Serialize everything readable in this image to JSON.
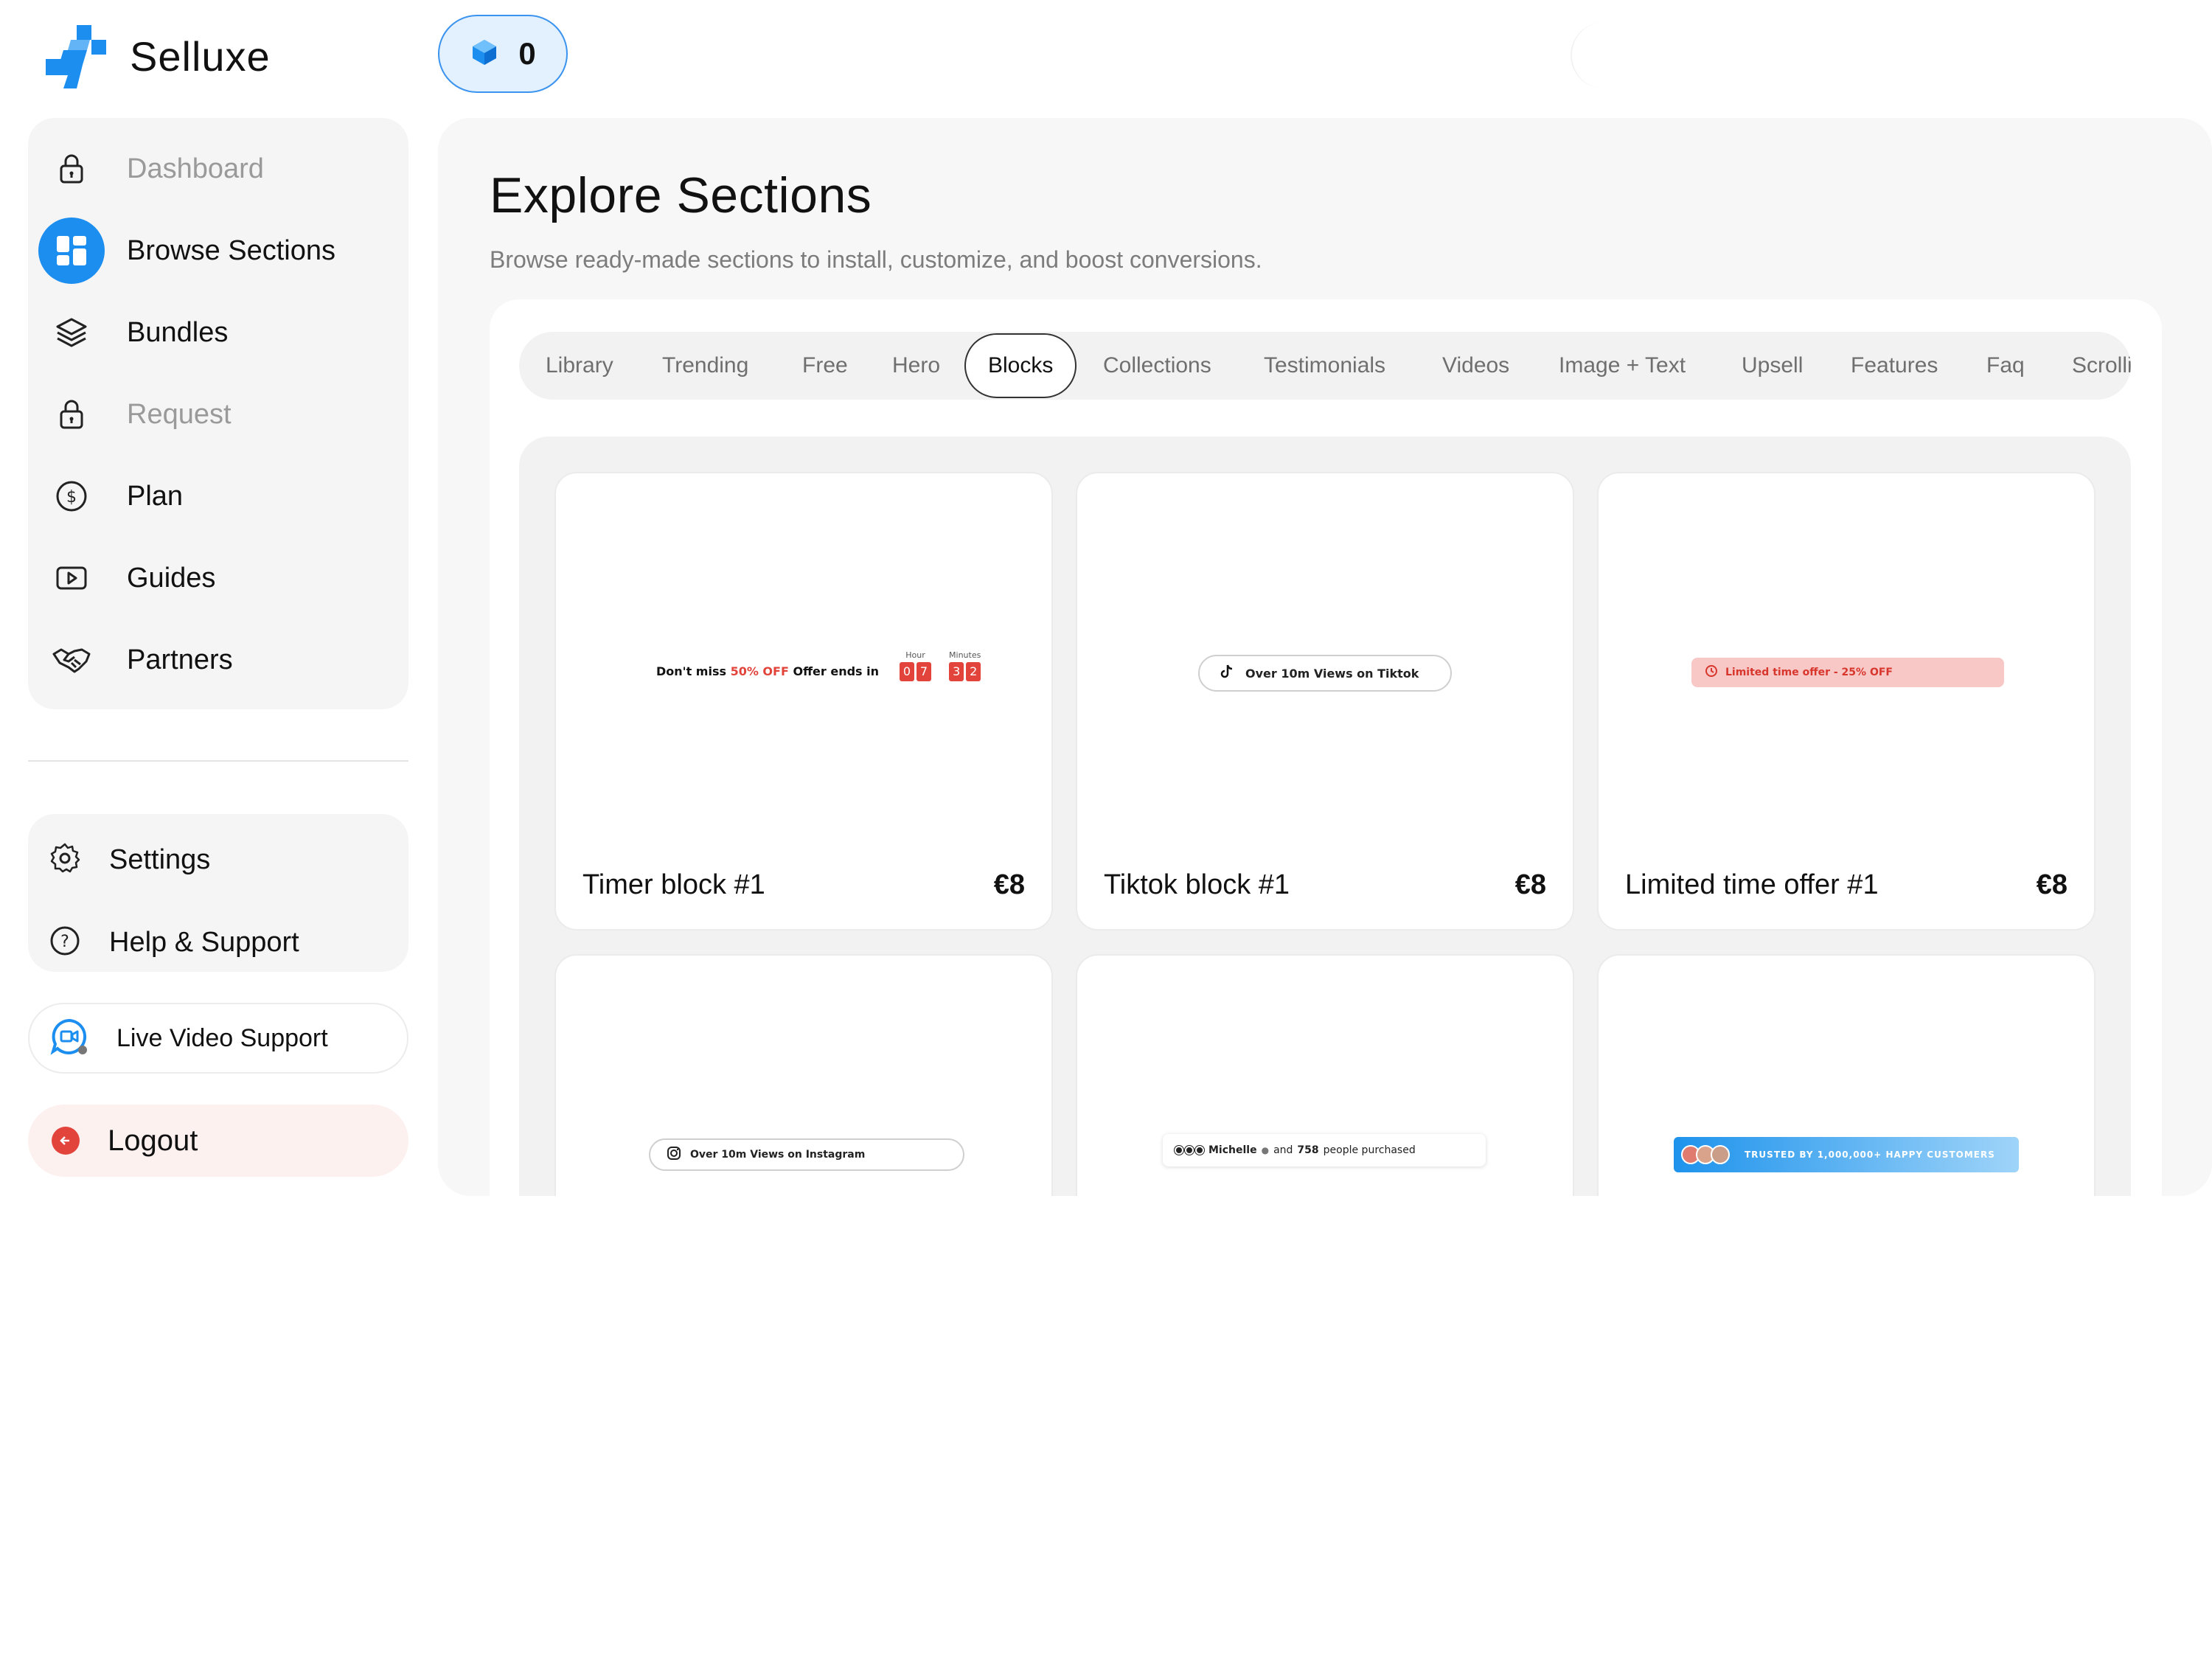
{
  "app": {
    "name": "Selluxe"
  },
  "credits": {
    "value": "0"
  },
  "sidebar": {
    "items": [
      {
        "label": "Dashboard",
        "icon": "lock-icon"
      },
      {
        "label": "Browse Sections",
        "icon": "grid-icon"
      },
      {
        "label": "Bundles",
        "icon": "layers-icon"
      },
      {
        "label": "Request",
        "icon": "lock-icon"
      },
      {
        "label": "Plan",
        "icon": "dollar-icon"
      },
      {
        "label": "Guides",
        "icon": "video-icon"
      },
      {
        "label": "Partners",
        "icon": "handshake-icon"
      }
    ],
    "settings": {
      "label": "Settings",
      "icon": "gear-icon"
    },
    "help": {
      "label": "Help & Support",
      "icon": "question-icon"
    },
    "live_support": {
      "label": "Live Video Support",
      "icon": "video-chat-icon"
    },
    "logout": {
      "label": "Logout",
      "icon": "arrow-left-icon"
    }
  },
  "main": {
    "title": "Explore Sections",
    "subtitle": "Browse ready-made sections to install, customize, and boost conversions.",
    "tabs": [
      "Library",
      "Trending",
      "Free",
      "Hero",
      "Blocks",
      "Collections",
      "Testimonials",
      "Videos",
      "Image + Text",
      "Upsell",
      "Features",
      "Faq",
      "Scrolli"
    ],
    "active_tab": "Blocks",
    "cards": [
      {
        "title": "Timer block #1",
        "price": "€8"
      },
      {
        "title": "Tiktok block #1",
        "price": "€8"
      },
      {
        "title": "Limited time offer #1",
        "price": "€8"
      },
      {
        "title": "",
        "price": ""
      },
      {
        "title": "",
        "price": ""
      },
      {
        "title": "",
        "price": ""
      }
    ],
    "previews": {
      "timer": {
        "text_prefix": "Don't miss",
        "text_highlight": "50% OFF",
        "text_suffix": "Offer ends in",
        "hour_label": "Hour",
        "minutes_label": "Minutes",
        "hour_digits": [
          "0",
          "7"
        ],
        "minute_digits": [
          "3",
          "2"
        ]
      },
      "tiktok": {
        "text": "Over 10m Views on Tiktok"
      },
      "offer": {
        "text": "Limited time offer - 25% OFF"
      },
      "instagram": {
        "text": "Over 10m Views on Instagram"
      },
      "michelle": {
        "name": "Michelle",
        "connector": "and",
        "count": "758",
        "suffix": "people purchased"
      },
      "trusted": {
        "text": "TRUSTED BY 1,000,000+ HAPPY CUSTOMERS"
      }
    }
  },
  "colors": {
    "accent": "#1c8ef0",
    "danger": "#e2443b",
    "panel": "#f5f5f5"
  }
}
